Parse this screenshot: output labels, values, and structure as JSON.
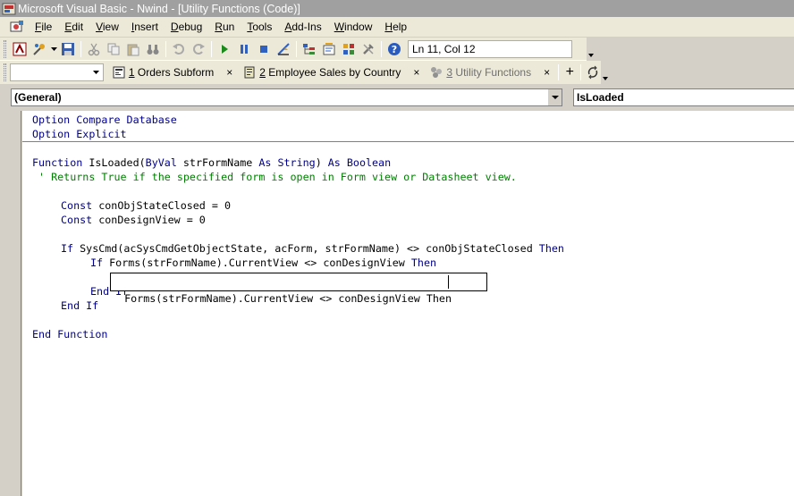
{
  "window": {
    "title": "Microsoft Visual Basic - Nwind - [Utility Functions (Code)]"
  },
  "menu": [
    {
      "key": "F",
      "rest": "ile"
    },
    {
      "key": "E",
      "rest": "dit"
    },
    {
      "key": "V",
      "rest": "iew"
    },
    {
      "key": "I",
      "rest": "nsert"
    },
    {
      "key": "D",
      "rest": "ebug"
    },
    {
      "key": "R",
      "rest": "un"
    },
    {
      "key": "T",
      "rest": "ools"
    },
    {
      "key": "A",
      "rest": "dd-Ins"
    },
    {
      "key": "W",
      "rest": "indow"
    },
    {
      "key": "H",
      "rest": "elp"
    }
  ],
  "toolbar": {
    "position_label": "Ln 11, Col 12"
  },
  "window_tabs": [
    {
      "key": "1",
      "rest": " Orders Subform",
      "close": "×",
      "active": true
    },
    {
      "key": "2",
      "rest": " Employee Sales by Country",
      "close": "×",
      "active": true
    },
    {
      "key": "3",
      "rest": " Utility Functions",
      "close": "×",
      "active": false
    }
  ],
  "tabs_add": "+",
  "object_combo": "(General)",
  "procedure_combo": "IsLoaded",
  "code": {
    "l1_kw": "Option Compare Database",
    "l2_kw": "Option Explicit",
    "l3_kw1": "Function",
    "l3_id1": " IsLoaded(",
    "l3_kw2": "ByVal",
    "l3_id2": " strFormName ",
    "l3_kw3": "As String",
    "l3_id3": ") ",
    "l3_kw4": "As Boolean",
    "l4_cm": " ' Returns True if the specified form is open in Form view or Datasheet view.",
    "l5_kw": "Const",
    "l5_id": " conObjStateClosed = 0",
    "l6_kw": "Const",
    "l6_id": " conDesignView = 0",
    "l7_kw1": "If",
    "l7_id": " SysCmd(acSysCmdGetObjectState, acForm, strFormName) <> conObjStateClosed ",
    "l7_kw2": "Then",
    "l8_kw1": "If",
    "l8_id": " Forms(strFormName).CurrentView <> conDesignView ",
    "l8_kw2": "Then",
    "l9_kw": "End If",
    "l10_kw": "End If",
    "l11_kw": "End Function"
  },
  "tooltip": {
    "text": "Forms(strFormName).CurrentView <> conDesignView Then"
  }
}
